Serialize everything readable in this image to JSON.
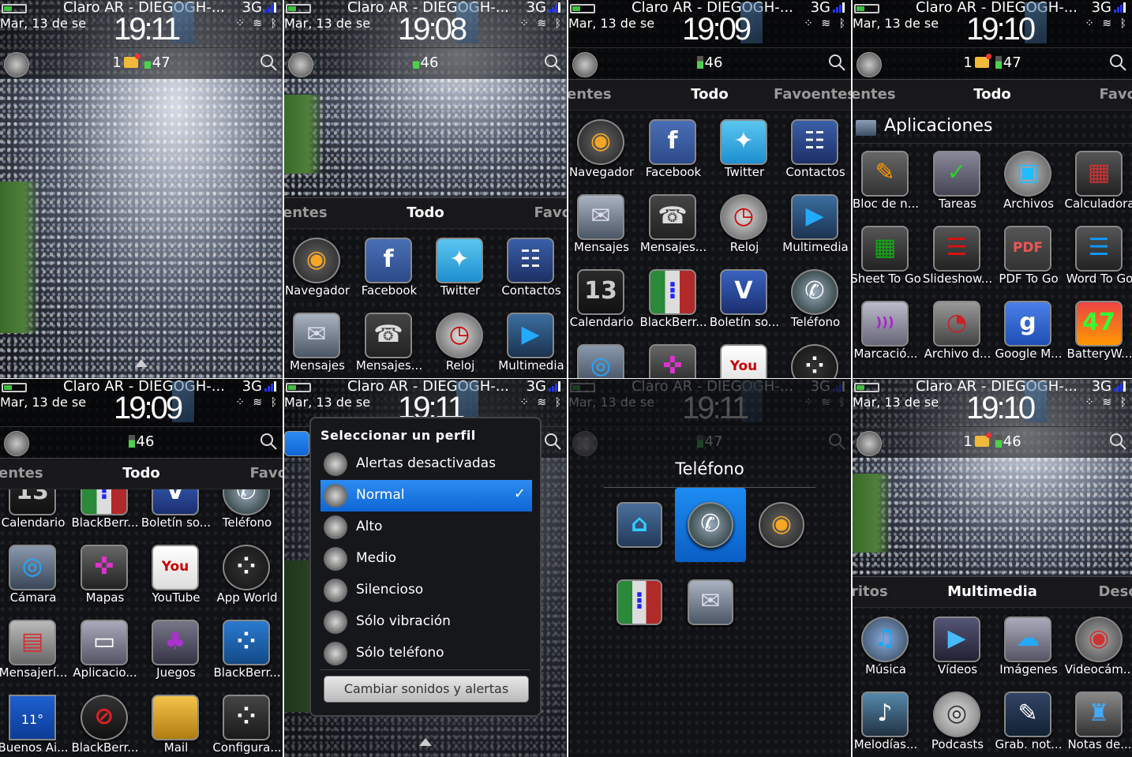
{
  "panels": [
    {
      "id": "home-1911",
      "status": {
        "carrier": "Claro AR - DIEGOGH-...",
        "date": "Mar, 13 de se",
        "time": "19:11",
        "network": "3G"
      },
      "notif": {
        "mail": "1",
        "battery": "47"
      },
      "wallpaper_until": "full",
      "arrow": true
    },
    {
      "id": "home-1908",
      "status": {
        "carrier": "Claro AR - DIEGOGH-...",
        "date": "Mar, 13 de se",
        "time": "19:08",
        "network": "3G"
      },
      "notif": {
        "battery": "46"
      },
      "tabs": [
        "entes",
        "Todo",
        "Favo"
      ],
      "apps": [
        [
          "Navegador",
          "browser-icon"
        ],
        [
          "Facebook",
          "facebook-icon"
        ],
        [
          "Twitter",
          "twitter-icon"
        ],
        [
          "Contactos",
          "contacts-icon"
        ],
        [
          "Mensajes",
          "messages-icon"
        ],
        [
          "Mensajes...",
          "text-messages-icon"
        ],
        [
          "Reloj",
          "clock-icon"
        ],
        [
          "Multimedia",
          "media-icon"
        ]
      ]
    },
    {
      "id": "all-1909",
      "status": {
        "carrier": "Claro AR - DIEGOGH-...",
        "date": "Mar, 13 de se",
        "time": "19:09",
        "network": "3G"
      },
      "notif": {
        "battery": "46"
      },
      "tabs": [
        "entes",
        "Todo",
        "Favoentes"
      ],
      "apps": [
        [
          "Navegador",
          "browser-icon"
        ],
        [
          "Facebook",
          "facebook-icon"
        ],
        [
          "Twitter",
          "twitter-icon"
        ],
        [
          "Contactos",
          "contacts-icon"
        ],
        [
          "Mensajes",
          "messages-icon"
        ],
        [
          "Mensajes...",
          "text-messages-icon"
        ],
        [
          "Reloj",
          "clock-icon"
        ],
        [
          "Multimedia",
          "media-icon"
        ],
        [
          "Calendario",
          "calendar-icon"
        ],
        [
          "BlackBerr...",
          "bbm-icon"
        ],
        [
          "Boletín so...",
          "newsletter-icon"
        ],
        [
          "Teléfono",
          "phone-icon"
        ],
        [
          "",
          "camera-icon"
        ],
        [
          "",
          "maps-icon"
        ],
        [
          "",
          "youtube-icon"
        ],
        [
          "",
          "app-world-icon"
        ]
      ]
    },
    {
      "id": "apps-folder-1910",
      "status": {
        "carrier": "Claro AR - DIEGOGH-...",
        "date": "Mar, 13 de se",
        "time": "19:10",
        "network": "3G"
      },
      "notif": {
        "mail": "1",
        "battery": "47"
      },
      "tabs": [
        "entes",
        "Todo",
        "Favo"
      ],
      "folder": "Aplicaciones",
      "apps": [
        [
          "Bloc de n...",
          "memo-icon"
        ],
        [
          "Tareas",
          "tasks-icon"
        ],
        [
          "Archivos",
          "files-icon"
        ],
        [
          "Calculadora",
          "calculator-icon"
        ],
        [
          "Sheet To Go",
          "xls-icon"
        ],
        [
          "Slideshow...",
          "ppt-icon"
        ],
        [
          "PDF To Go",
          "pdf-icon"
        ],
        [
          "Word To Go",
          "doc-icon"
        ],
        [
          "Marcació...",
          "voice-dial-icon"
        ],
        [
          "Archivo d...",
          "file-icon"
        ],
        [
          "Google M...",
          "google-maps-icon"
        ],
        [
          "BatteryW...",
          "battery-watch-icon"
        ]
      ]
    },
    {
      "id": "all-1909-b",
      "status": {
        "carrier": "Claro AR - DIEGOGH-...",
        "date": "Mar, 13 de se",
        "time": "19:09",
        "network": "3G"
      },
      "notif": {
        "battery": "46"
      },
      "tabs": [
        "entes",
        "Todo",
        "Favo"
      ],
      "apps": [
        [
          "Calendario",
          "calendar-icon"
        ],
        [
          "BlackBerr...",
          "bbm-icon"
        ],
        [
          "Boletín so...",
          "newsletter-icon"
        ],
        [
          "Teléfono",
          "phone-icon"
        ],
        [
          "Cámara",
          "camera-icon"
        ],
        [
          "Mapas",
          "maps-icon"
        ],
        [
          "YouTube",
          "youtube-icon"
        ],
        [
          "App World",
          "app-world-icon"
        ],
        [
          "Mensajerí...",
          "im-icon"
        ],
        [
          "Aplicacio...",
          "apps-folder-icon"
        ],
        [
          "Juegos",
          "games-icon"
        ],
        [
          "BlackBerr...",
          "bb-icon"
        ],
        [
          "Buenos Ai...",
          "weather-icon",
          "11°"
        ],
        [
          "BlackBerr...",
          "bb-protect-icon"
        ],
        [
          "Mail",
          "mail-folder-icon"
        ],
        [
          "Configura...",
          "settings-icon"
        ]
      ]
    },
    {
      "id": "profile-1911",
      "status": {
        "carrier": "Claro AR - DIEGOGH-...",
        "date": "Mar, 13 de se",
        "time": "19:11",
        "network": "3G"
      },
      "arrow": true,
      "profile_menu": {
        "title": "Seleccionar un perfil",
        "items": [
          {
            "label": "Alertas desactivadas"
          },
          {
            "label": "Normal",
            "selected": true
          },
          {
            "label": "Alto"
          },
          {
            "label": "Medio"
          },
          {
            "label": "Silencioso"
          },
          {
            "label": "Sólo vibración"
          },
          {
            "label": "Sólo teléfono"
          }
        ],
        "button": "Cambiar sonidos y alertas"
      }
    },
    {
      "id": "phone-popup-1911",
      "status": {
        "carrier": "Claro AR - DIEGOGH-...",
        "date": "Mar, 13 de se",
        "time": "19:11",
        "network": "3G"
      },
      "notif": {
        "battery": "47"
      },
      "popup": {
        "title": "Teléfono",
        "items": [
          {
            "icon": "home-icon"
          },
          {
            "icon": "phone-icon",
            "selected": true
          },
          {
            "icon": "browser-icon"
          },
          {
            "icon": "bbm-icon"
          },
          {
            "icon": "messages-icon"
          }
        ]
      }
    },
    {
      "id": "multimedia-1910",
      "status": {
        "carrier": "Claro AR - DIEGOGH-...",
        "date": "Mar, 13 de se",
        "time": "19:10",
        "network": "3G"
      },
      "notif": {
        "mail": "1",
        "battery": "46"
      },
      "tabs": [
        "ritos",
        "Multimedia",
        "Desc"
      ],
      "apps": [
        [
          "Música",
          "music-icon"
        ],
        [
          "Vídeos",
          "videos-icon"
        ],
        [
          "Imágenes",
          "pictures-icon"
        ],
        [
          "Videocám...",
          "video-camera-icon"
        ],
        [
          "Melodías...",
          "ringtones-icon"
        ],
        [
          "Podcasts",
          "podcasts-icon"
        ],
        [
          "Grab. not...",
          "voice-notes-icon"
        ],
        [
          "Notas de...",
          "notes-icon"
        ]
      ]
    }
  ],
  "colors": {
    "accent": "#1d7ee8",
    "battery_green": "#3fbf3f",
    "signal_blue": "#2233ff"
  }
}
